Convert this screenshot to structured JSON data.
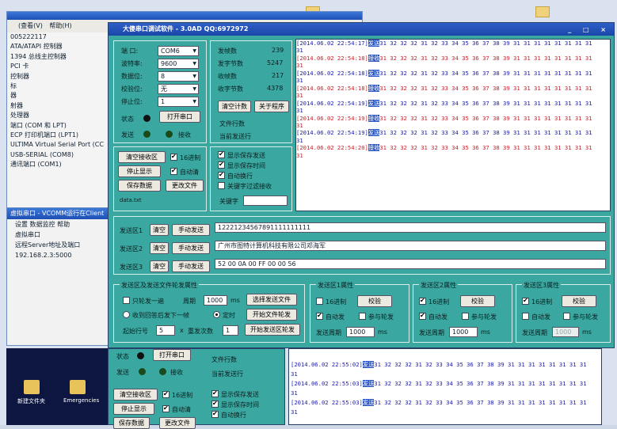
{
  "colors": {
    "teal": "#3aa7a0",
    "title_blue": "#1d4fb5",
    "send_blue": "#1a1aa8",
    "recv_red": "#c8202a"
  },
  "bg_window": {
    "menu": [
      "(查看(V)",
      "帮助(H)"
    ],
    "tree": [
      "005222117",
      "ATA/ATAPI 控制器",
      "1394 总线主控制器",
      "PCI 卡",
      "控制器",
      "标",
      "器",
      "射器",
      "处理器",
      "端口 (COM 和 LPT)",
      "ECP 打印机端口 (LPT1)",
      "ULTIMA Virtual Serial Port (CC",
      "USB-SERIAL (COM8)",
      "通讯端口 (COM1)"
    ]
  },
  "vcomm": {
    "title": "虚拟串口 - VCOMM运行在Client",
    "rows": [
      "设置 数据监控 帮助",
      "虚拟串口",
      "远程Server地址及端口",
      "192.168.2.3:5000"
    ]
  },
  "desktop": {
    "labels": [
      "新建文件夹",
      "Emergencies"
    ]
  },
  "main": {
    "title": "大傻串口调试软件 - 3.0AD    QQ:6972972",
    "controls": "_ □ ×",
    "port": {
      "labels": [
        "端  口:",
        "波特率:",
        "数据位:",
        "校验位:",
        "停止位:"
      ],
      "values": [
        "COM6",
        "9600",
        "8",
        "无",
        "1"
      ],
      "open_btn": "打开串口",
      "state_label": "状态",
      "send_label": "发送",
      "recv_label": "接收"
    },
    "stats": {
      "labels": [
        "发帧数",
        "发字节数",
        "收帧数",
        "收字节数"
      ],
      "values": [
        "239",
        "5247",
        "217",
        "4378"
      ],
      "clear_btn": "清空计数",
      "about_btn": "关于程序",
      "file_rows": "文件行数",
      "current_row": "当前发送行"
    },
    "recv_opts": {
      "clear_btn": "清空接收区",
      "stop_btn": "停止显示",
      "save_btn": "保存数据",
      "change_btn": "更改文件",
      "hex": "16进制",
      "auto_clear": "自动清",
      "path": "data.txt"
    },
    "disp_opts": {
      "items": [
        "显示保存发送",
        "显示保存时间",
        "自动换行",
        "关键字过滤接收"
      ],
      "keyword_label": "关键字"
    },
    "recv_lines": [
      {
        "color": "#1a1aa8",
        "ts": "[2014.06.02 22:54:17]",
        "tag": "发送",
        "data": "31 32 32 32 31 32 33 34 35 36 37 38 39 31 31 31 31 31 31 31 31"
      },
      {
        "color": "#1a1aa8",
        "ts": "",
        "tag": "",
        "data": "31"
      },
      {
        "color": "#c8202a",
        "ts": "[2014.06.02 22:54:18]",
        "tag": "接收",
        "data": "31 32 32 32 31 32 33 34 35 36 37 38 39 31 31 31 31 31 31 31 31"
      },
      {
        "color": "#c8202a",
        "ts": "",
        "tag": "",
        "data": "31"
      },
      {
        "color": "#1a1aa8",
        "ts": "[2014.06.02 22:54:18]",
        "tag": "发送",
        "data": "31 32 32 32 31 32 33 34 35 36 37 38 39 31 31 31 31 31 31 31 31"
      },
      {
        "color": "#1a1aa8",
        "ts": "",
        "tag": "",
        "data": "31"
      },
      {
        "color": "#c8202a",
        "ts": "[2014.06.02 22:54:18]",
        "tag": "接收",
        "data": "31 32 32 32 31 32 33 34 35 36 37 38 39 31 31 31 31 31 31 31 31"
      },
      {
        "color": "#c8202a",
        "ts": "",
        "tag": "",
        "data": "31"
      },
      {
        "color": "#1a1aa8",
        "ts": "[2014.06.02 22:54:19]",
        "tag": "发送",
        "data": "31 32 32 32 31 32 33 34 35 36 37 38 39 31 31 31 31 31 31 31 31"
      },
      {
        "color": "#1a1aa8",
        "ts": "",
        "tag": "",
        "data": "31"
      },
      {
        "color": "#c8202a",
        "ts": "[2014.06.02 22:54:19]",
        "tag": "接收",
        "data": "31 32 32 32 31 32 33 34 35 36 37 38 39 31 31 31 31 31 31 31 31"
      },
      {
        "color": "#c8202a",
        "ts": "",
        "tag": "",
        "data": "31"
      },
      {
        "color": "#1a1aa8",
        "ts": "[2014.06.02 22:54:19]",
        "tag": "发送",
        "data": "31 32 32 32 31 32 33 34 35 36 37 38 39 31 31 31 31 31 31 31 31"
      },
      {
        "color": "#1a1aa8",
        "ts": "",
        "tag": "",
        "data": "31"
      },
      {
        "color": "#c8202a",
        "ts": "[2014.06.02 22:54:20]",
        "tag": "接收",
        "data": "31 32 32 32 31 32 33 34 35 36 37 38 39 31 31 31 31 31 31 31 31"
      },
      {
        "color": "#c8202a",
        "ts": "",
        "tag": "",
        "data": "31"
      }
    ],
    "send_areas": [
      {
        "label": "发送区1",
        "clear": "清空",
        "manual": "手动发送",
        "value": "12221234567891111111111"
      },
      {
        "label": "发送区2",
        "clear": "清空",
        "manual": "手动发送",
        "value": "广州市图特计算机科技有限公司邓海军"
      },
      {
        "label": "发送区3",
        "clear": "清空",
        "manual": "手动发送",
        "value": "52 00 0A 00 FF 00 00 56"
      }
    ],
    "bottom": {
      "file_group": "发送区及发送文件轮发属性",
      "send_once": "只轮发一遍",
      "period_label": "周期",
      "period_value": "1000",
      "ms": "ms",
      "select_file_btn": "选择发送文件",
      "start_file_btn": "开始文件轮发",
      "recv_next": "收到回答后发下一帧",
      "timed": "定时",
      "start_area_btn": "开始发送区轮发",
      "start_no_label": "起始行号",
      "start_no": "5",
      "times_label": "重发次数",
      "times_x": "x",
      "times_value": "1",
      "areas": [
        {
          "title": "发送区1属性",
          "hex": "16进制",
          "hex_on": false,
          "verify_btn": "校验",
          "auto_send": "自动发",
          "auto_on": true,
          "join_label": "参与轮发",
          "join_on": false,
          "period_label": "发送周期",
          "period": "1000",
          "ms": "ms"
        },
        {
          "title": "发送区2属性",
          "hex": "16进制",
          "hex_on": true,
          "verify_btn": "校验",
          "auto_send": "自动发",
          "auto_on": true,
          "join_label": "参与轮发",
          "join_on": false,
          "period_label": "发送周期",
          "period": "1000",
          "ms": "ms"
        },
        {
          "title": "发送区3属性",
          "hex": "16进制",
          "hex_on": true,
          "verify_btn": "校验",
          "auto_send": "自动发",
          "auto_on": false,
          "join_label": "参与轮发",
          "join_on": false,
          "period_label": "发送周期",
          "period": "1000",
          "ms": "ms"
        }
      ]
    }
  },
  "second": {
    "state_label": "状态",
    "open_btn": "打开串口",
    "send_label": "发送",
    "recv_label": "接收",
    "file_rows": "文件行数",
    "current_row": "当前发送行",
    "clear_btn": "清空接收区",
    "hex": "16进制",
    "stop_btn": "停止显示",
    "auto_clear": "自动清",
    "save_btn": "保存数据",
    "change_btn": "更改文件",
    "items": [
      "显示保存发送",
      "显示保存时间",
      "自动换行"
    ],
    "lines": [
      {
        "ts": "[2014.06.02 22:55:02]",
        "tag": "发送",
        "data": "31 32 32 32 31 32 33 34 35 36 37 38 39 31 31 31 31 31 31 31 31"
      },
      {
        "ts": "",
        "tag": "",
        "data": "31"
      },
      {
        "ts": "[2014.06.02 22:55:03]",
        "tag": "发送",
        "data": "31 32 32 32 31 32 33 34 35 36 37 38 39 31 31 31 31 31 31 31 31"
      },
      {
        "ts": "",
        "tag": "",
        "data": "31"
      },
      {
        "ts": "[2014.06.02 22:55:03]",
        "tag": "发送",
        "data": "31 32 32 32 31 32 33 34 35 36 37 38 39 31 31 31 31 31 31 31 31"
      },
      {
        "ts": "",
        "tag": "",
        "data": "31"
      }
    ]
  }
}
